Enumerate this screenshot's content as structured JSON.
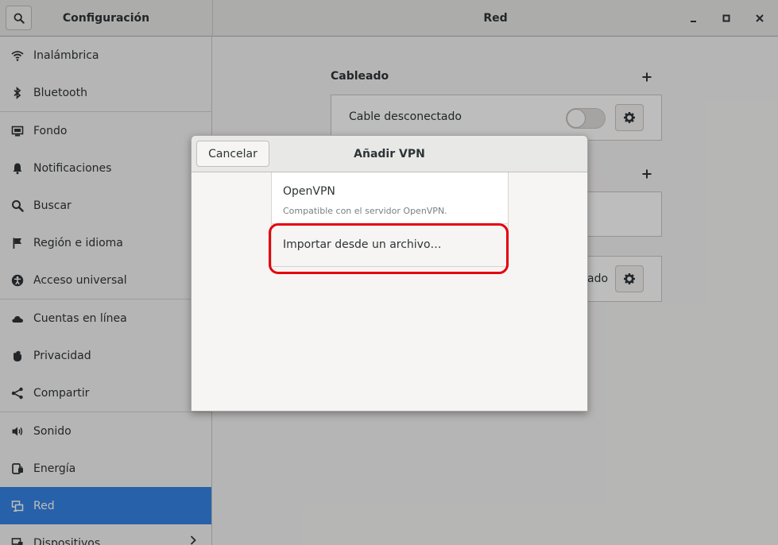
{
  "app": {
    "title": "Configuración"
  },
  "page": {
    "title": "Red"
  },
  "sidebar": {
    "items": [
      {
        "label": "Inalámbrica",
        "icon": "wifi-icon"
      },
      {
        "label": "Bluetooth",
        "icon": "bluetooth-icon"
      },
      {
        "label": "Fondo",
        "icon": "background-icon"
      },
      {
        "label": "Notificaciones",
        "icon": "bell-icon"
      },
      {
        "label": "Buscar",
        "icon": "search-icon"
      },
      {
        "label": "Región e idioma",
        "icon": "flag-icon"
      },
      {
        "label": "Acceso universal",
        "icon": "accessibility-icon"
      },
      {
        "label": "Cuentas en línea",
        "icon": "cloud-icon"
      },
      {
        "label": "Privacidad",
        "icon": "hand-icon"
      },
      {
        "label": "Compartir",
        "icon": "share-icon"
      },
      {
        "label": "Sonido",
        "icon": "speaker-icon"
      },
      {
        "label": "Energía",
        "icon": "power-plug-icon"
      },
      {
        "label": "Red",
        "icon": "network-icon",
        "active": true
      },
      {
        "label": "Dispositivos",
        "icon": "devices-icon"
      }
    ]
  },
  "main": {
    "wired": {
      "title": "Cableado",
      "connection_label": "Cable desconectado",
      "switch_on": false
    },
    "vpn_partial_text": "ado"
  },
  "dialog": {
    "title": "Añadir VPN",
    "cancel_label": "Cancelar",
    "options": [
      {
        "name": "OpenVPN",
        "description": "Compatible con el servidor OpenVPN."
      },
      {
        "name": "Importar desde un archivo…"
      }
    ]
  },
  "colors": {
    "accent": "#3584e4",
    "highlight": "#e5000c"
  }
}
